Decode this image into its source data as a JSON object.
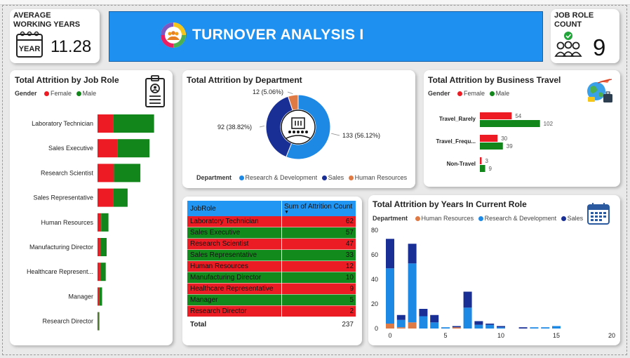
{
  "colors": {
    "female": "#ed1c24",
    "male": "#12861a",
    "rnd": "#1e88e5",
    "sales": "#1a2f95",
    "hr": "#e07a45",
    "banner": "#1e90ef",
    "table_red": "#ec1c24",
    "table_green": "#138a1c"
  },
  "kpi_years": {
    "label": "AVERAGE WORKING YEARS",
    "icon_text": "YEAR",
    "value": "11.28"
  },
  "banner": {
    "title": "TURNOVER ANALYSIS I"
  },
  "kpi_roles": {
    "label": "JOB ROLE COUNT",
    "value": "9"
  },
  "job_role_card": {
    "title": "Total Attrition by Job Role",
    "legend_title": "Gender",
    "legend": [
      "Female",
      "Male"
    ],
    "chart_data": {
      "type": "bar",
      "orientation": "horizontal",
      "stacked": true,
      "categories": [
        "Laboratory Technician",
        "Sales Executive",
        "Research Scientist",
        "Sales Representative",
        "Human Resources",
        "Manufacturing Director",
        "Healthcare Represent...",
        "Manager",
        "Research Director"
      ],
      "series": [
        {
          "name": "Female",
          "values": [
            17,
            22,
            18,
            17,
            4,
            3,
            3,
            2,
            1
          ]
        },
        {
          "name": "Male",
          "values": [
            45,
            35,
            29,
            16,
            8,
            7,
            6,
            3,
            1
          ]
        }
      ]
    }
  },
  "department_card": {
    "title": "Total Attrition by Department",
    "legend_title": "Department",
    "legend": [
      "Research & Development",
      "Sales",
      "Human Resources"
    ],
    "chart_data": {
      "type": "pie",
      "donut": true,
      "categories": [
        "Research & Development",
        "Sales",
        "Human Resources"
      ],
      "values": [
        133,
        92,
        12
      ],
      "labels": [
        "133 (56.12%)",
        "92 (38.82%)",
        "12 (5.06%)"
      ]
    }
  },
  "travel_card": {
    "title": "Total Attrition by Business Travel",
    "legend_title": "Gender",
    "legend": [
      "Female",
      "Male"
    ],
    "chart_data": {
      "type": "bar",
      "orientation": "horizontal",
      "categories": [
        "Travel_Rarely",
        "Travel_Frequ...",
        "Non-Travel"
      ],
      "series": [
        {
          "name": "Female",
          "values": [
            54,
            30,
            3
          ]
        },
        {
          "name": "Male",
          "values": [
            102,
            39,
            9
          ]
        }
      ]
    }
  },
  "table_card": {
    "headers": [
      "JobRole",
      "Sum of Attrition Count"
    ],
    "rows": [
      {
        "role": "Laboratory Technician",
        "count": "62"
      },
      {
        "role": "Sales Executive",
        "count": "57"
      },
      {
        "role": "Research Scientist",
        "count": "47"
      },
      {
        "role": "Sales Representative",
        "count": "33"
      },
      {
        "role": "Human Resources",
        "count": "12"
      },
      {
        "role": "Manufacturing Director",
        "count": "10"
      },
      {
        "role": "Healthcare Representative",
        "count": "9"
      },
      {
        "role": "Manager",
        "count": "5"
      },
      {
        "role": "Research Director",
        "count": "2"
      }
    ],
    "total_label": "Total",
    "total_value": "237"
  },
  "years_card": {
    "title": "Total Attrition by Years In Current Role",
    "legend_title": "Department",
    "legend": [
      "Human Resources",
      "Research & Development",
      "Sales"
    ],
    "chart_data": {
      "type": "bar",
      "stacked": true,
      "x": [
        0,
        1,
        2,
        3,
        4,
        5,
        6,
        7,
        8,
        9,
        10,
        11,
        12,
        13,
        14,
        15
      ],
      "series": [
        {
          "name": "Human Resources",
          "values": [
            4,
            1,
            5,
            0,
            0,
            0,
            1,
            0,
            0,
            0,
            0,
            0,
            0,
            0,
            0,
            0
          ]
        },
        {
          "name": "Research & Development",
          "values": [
            45,
            6,
            48,
            10,
            5,
            1,
            0,
            17,
            3,
            3,
            1,
            0,
            0,
            1,
            1,
            2
          ]
        },
        {
          "name": "Sales",
          "values": [
            24,
            4,
            16,
            6,
            6,
            0,
            1,
            13,
            3,
            1,
            1,
            0,
            1,
            0,
            0,
            0
          ]
        }
      ],
      "xticks": [
        0,
        5,
        10,
        15,
        20
      ],
      "yticks": [
        0,
        20,
        40,
        60,
        80
      ],
      "xlim": [
        0,
        20
      ],
      "ylim": [
        0,
        80
      ]
    }
  }
}
